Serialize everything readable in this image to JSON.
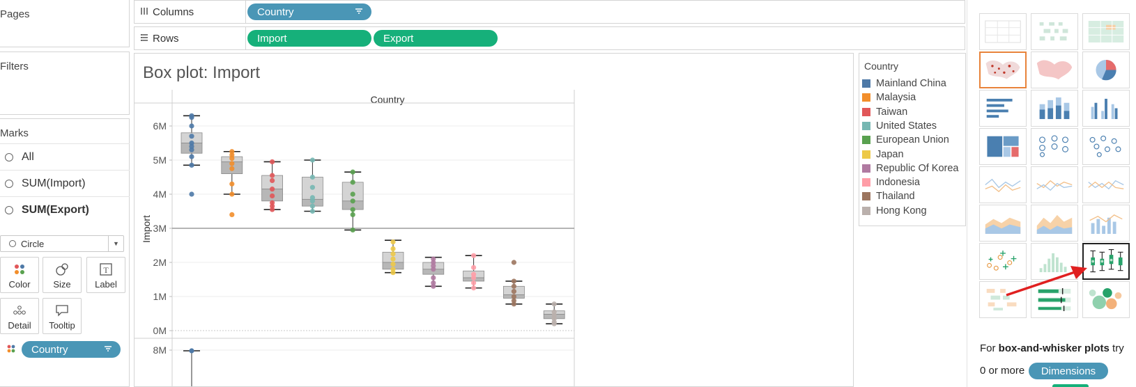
{
  "left_panel": {
    "pages_label": "Pages",
    "filters_label": "Filters",
    "marks_label": "Marks",
    "marks_items": [
      "All",
      "SUM(Import)",
      "SUM(Export)"
    ],
    "mark_type": "Circle",
    "buttons": {
      "color": "Color",
      "size": "Size",
      "label": "Label",
      "detail": "Detail",
      "tooltip": "Tooltip"
    },
    "color_pill": "Country"
  },
  "shelves": {
    "columns_label": "Columns",
    "rows_label": "Rows",
    "columns_pill": "Country",
    "rows_pills": [
      "Import",
      "Export"
    ]
  },
  "view": {
    "title": "Box plot: Import"
  },
  "chart_data": {
    "type": "box",
    "header": "Country",
    "ylabel": "Import",
    "yticks": [
      "6M",
      "5M",
      "4M",
      "3M",
      "2M",
      "1M",
      "0M"
    ],
    "ylim": [
      0,
      6800000
    ],
    "reference_line": 3000000,
    "lower_pane_ytick": "8M",
    "categories": [
      "Mainland China",
      "Malaysia",
      "Taiwan",
      "United States",
      "European Union",
      "Japan",
      "Republic Of Korea",
      "Indonesia",
      "Thailand",
      "Hong Kong"
    ],
    "boxes": [
      {
        "q1": 5200000,
        "median": 5500000,
        "q3": 5800000,
        "low": 4850000,
        "high": 6300000,
        "points": [
          6300000,
          6250000,
          6000000,
          5700000,
          5500000,
          5400000,
          5300000,
          5100000,
          4850000,
          4000000
        ]
      },
      {
        "q1": 4600000,
        "median": 4950000,
        "q3": 5100000,
        "low": 4000000,
        "high": 5250000,
        "points": [
          5250000,
          5150000,
          5050000,
          4900000,
          4750000,
          4300000,
          4000000,
          3400000
        ]
      },
      {
        "q1": 3800000,
        "median": 4150000,
        "q3": 4550000,
        "low": 3550000,
        "high": 4950000,
        "points": [
          4950000,
          4550000,
          4400000,
          4150000,
          3950000,
          3750000,
          3650000,
          3550000
        ]
      },
      {
        "q1": 3650000,
        "median": 3850000,
        "q3": 4500000,
        "low": 3500000,
        "high": 5000000,
        "points": [
          5000000,
          4500000,
          4200000,
          3900000,
          3800000,
          3650000,
          3500000
        ]
      },
      {
        "q1": 3550000,
        "median": 3800000,
        "q3": 4350000,
        "low": 2950000,
        "high": 4650000,
        "points": [
          4650000,
          4350000,
          4000000,
          3800000,
          3550000,
          3400000,
          2950000
        ]
      },
      {
        "q1": 1800000,
        "median": 2000000,
        "q3": 2300000,
        "low": 1700000,
        "high": 2650000,
        "points": [
          2600000,
          2400000,
          2250000,
          2100000,
          1950000,
          1800000,
          1700000
        ]
      },
      {
        "q1": 1650000,
        "median": 1800000,
        "q3": 2000000,
        "low": 1300000,
        "high": 2150000,
        "points": [
          2100000,
          2000000,
          1900000,
          1800000,
          1550000,
          1400000,
          1300000
        ]
      },
      {
        "q1": 1450000,
        "median": 1550000,
        "q3": 1750000,
        "low": 1250000,
        "high": 2200000,
        "points": [
          2200000,
          1850000,
          1650000,
          1550000,
          1400000,
          1250000
        ]
      },
      {
        "q1": 950000,
        "median": 1050000,
        "q3": 1300000,
        "low": 780000,
        "high": 1450000,
        "points": [
          2000000,
          1450000,
          1300000,
          1150000,
          1000000,
          880000,
          780000
        ]
      },
      {
        "q1": 350000,
        "median": 480000,
        "q3": 580000,
        "low": 200000,
        "high": 780000,
        "points": [
          780000,
          550000,
          450000,
          350000,
          250000,
          200000
        ]
      }
    ]
  },
  "legend": {
    "title": "Country",
    "items": [
      {
        "label": "Mainland China",
        "color": "#4e79a7"
      },
      {
        "label": "Malaysia",
        "color": "#f28e2b"
      },
      {
        "label": "Taiwan",
        "color": "#e15759"
      },
      {
        "label": "United States",
        "color": "#76b7b2"
      },
      {
        "label": "European Union",
        "color": "#59a14f"
      },
      {
        "label": "Japan",
        "color": "#edc948"
      },
      {
        "label": "Republic Of Korea",
        "color": "#b07aa1"
      },
      {
        "label": "Indonesia",
        "color": "#ff9da7"
      },
      {
        "label": "Thailand",
        "color": "#9c755f"
      },
      {
        "label": "Hong Kong",
        "color": "#bab0ac"
      }
    ]
  },
  "show_me": {
    "hint_prefix": "For ",
    "hint_bold": "box-and-whisker plots",
    "hint_suffix": " try",
    "hint_line2": "0 or more",
    "dimensions_pill": "Dimensions",
    "selected_chart": "box-and-whisker-plot",
    "tiles": [
      "text-table",
      "heat-map",
      "highlight-table",
      "symbol-map",
      "filled-map",
      "pie-chart",
      "horizontal-bars",
      "stacked-bars",
      "side-by-side-bars",
      "treemap",
      "circle-views",
      "side-by-side-circles",
      "lines-continuous",
      "lines-discrete",
      "dual-lines",
      "area-continuous",
      "area-discrete",
      "dual-combination",
      "scatter-plot",
      "histogram",
      "box-and-whisker-plot",
      "gantt-chart",
      "bullet-graph",
      "packed-bubbles"
    ]
  }
}
